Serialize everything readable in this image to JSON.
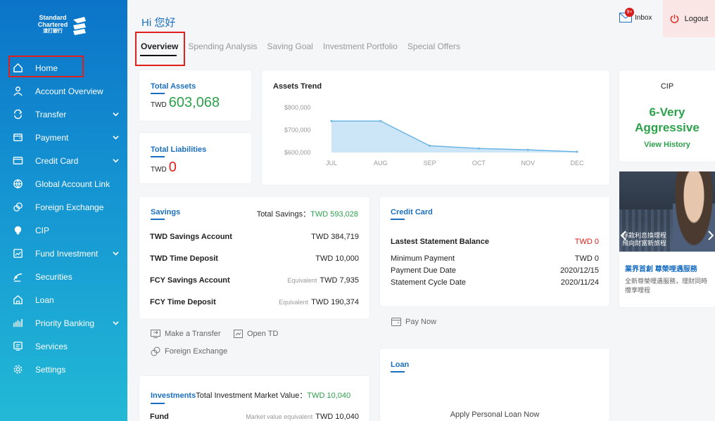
{
  "brand": {
    "line1": "Standard",
    "line2": "Chartered",
    "line3": "渣打銀行"
  },
  "sidebar": {
    "items": [
      {
        "label": "Home",
        "icon": "home-icon",
        "has_chevron": false
      },
      {
        "label": "Account Overview",
        "icon": "user-icon",
        "has_chevron": false
      },
      {
        "label": "Transfer",
        "icon": "transfer-icon",
        "has_chevron": true
      },
      {
        "label": "Payment",
        "icon": "wallet-icon",
        "has_chevron": true
      },
      {
        "label": "Credit Card",
        "icon": "credit-card-icon",
        "has_chevron": true
      },
      {
        "label": "Global Account Link",
        "icon": "globe-icon",
        "has_chevron": false
      },
      {
        "label": "Foreign Exchange",
        "icon": "exchange-icon",
        "has_chevron": false
      },
      {
        "label": "CIP",
        "icon": "cip-icon",
        "has_chevron": false
      },
      {
        "label": "Fund Investment",
        "icon": "fund-icon",
        "has_chevron": true
      },
      {
        "label": "Securities",
        "icon": "securities-icon",
        "has_chevron": false
      },
      {
        "label": "Loan",
        "icon": "loan-icon",
        "has_chevron": false
      },
      {
        "label": "Priority Banking",
        "icon": "priority-icon",
        "has_chevron": true
      },
      {
        "label": "Services",
        "icon": "services-icon",
        "has_chevron": false
      },
      {
        "label": "Settings",
        "icon": "gear-icon",
        "has_chevron": false
      }
    ]
  },
  "header": {
    "greeting": "Hi 您好",
    "inbox_label": "Inbox",
    "inbox_badge": "9+",
    "logout_label": "Logout",
    "tabs": [
      "Overview",
      "Spending Analysis",
      "Saving Goal",
      "Investment Portfolio",
      "Special Offers"
    ]
  },
  "total_assets": {
    "title": "Total Assets",
    "currency": "TWD",
    "value": "603,068"
  },
  "total_liabilities": {
    "title": "Total Liabilities",
    "currency": "TWD",
    "value": "0"
  },
  "assets_trend": {
    "title": "Assets Trend",
    "y_ticks": [
      "$800,000",
      "$700,000",
      "$600,000"
    ]
  },
  "chart_data": {
    "type": "area",
    "title": "Assets Trend",
    "categories": [
      "JUL",
      "AUG",
      "SEP",
      "OCT",
      "NOV",
      "DEC"
    ],
    "values": [
      740000,
      740000,
      630000,
      618000,
      612000,
      603068
    ],
    "ylim": [
      560000,
      840000
    ],
    "color": "#bfe0f6",
    "line_color": "#6cb4e4"
  },
  "cip": {
    "title": "CIP",
    "level": "6-Very",
    "level2": "Aggressive",
    "link": "View History"
  },
  "promo": {
    "banner_text1": "存款利息換理程",
    "banner_text2": "飛向財富新旅程",
    "title": "業界首創 尊榮哩遇服務",
    "desc": "全新尊榮哩遇服務，理財同時攢享哩程"
  },
  "savings": {
    "title": "Savings",
    "total_label": "Total Savings：",
    "total_value": "TWD 593,028",
    "rows": [
      {
        "label": "TWD Savings Account",
        "eq": "",
        "value": "TWD 384,719"
      },
      {
        "label": "TWD Time Deposit",
        "eq": "",
        "value": "TWD 10,000"
      },
      {
        "label": "FCY Savings Account",
        "eq": "Equivalent",
        "value": "TWD 7,935"
      },
      {
        "label": "FCY Time Deposit",
        "eq": "Equivalent",
        "value": "TWD 190,374"
      }
    ],
    "actions": [
      "Make a Transfer",
      "Open TD",
      "Foreign Exchange"
    ]
  },
  "credit_card": {
    "title": "Credit Card",
    "rows": [
      {
        "label": "Lastest Statement Balance",
        "value": "TWD 0"
      },
      {
        "label": "Minimum Payment",
        "value": "TWD 0"
      },
      {
        "label": "Payment Due Date",
        "value": "2020/12/15"
      },
      {
        "label": "Statement Cycle Date",
        "value": "2020/11/24"
      }
    ],
    "pay_now": "Pay Now"
  },
  "investments": {
    "title": "Investments",
    "total_label": "Total Investment Market Value：",
    "total_value": "TWD 10,040",
    "rows": [
      {
        "label": "Fund",
        "eq": "Market value equivalent",
        "value": "TWD 10,040"
      }
    ]
  },
  "loan": {
    "title": "Loan",
    "cta": "Apply Personal Loan Now"
  },
  "colors": {
    "accent": "#1b6fc1",
    "green": "#2ba14b",
    "red": "#e0201c"
  }
}
